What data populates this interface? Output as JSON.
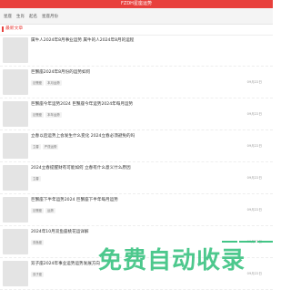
{
  "topbar": {
    "title": "FZDH星座运势"
  },
  "nav": [
    "星座",
    "生肖",
    "起名",
    "星座月份"
  ],
  "section": {
    "title": "最新文章"
  },
  "articles": [
    {
      "title": "属牛人2024年8月事业运势 属牛的人2024年8月的运程",
      "tags": [],
      "date": ""
    },
    {
      "title": "巨蟹座2024年8月份的运势如何",
      "tags": [
        "巨蟹座",
        "本月运势"
      ],
      "date": "09月22日"
    },
    {
      "title": "巨蟹座今年运势2024 巨蟹座今年运势2024年每月运势",
      "tags": [
        "巨蟹座",
        "本年运势"
      ],
      "date": "09月22日"
    },
    {
      "title": "立春以后运势上会发生什么变化 2024立春必须避免的吗",
      "tags": [
        "立春",
        "严谨运势"
      ],
      "date": "09月22日"
    },
    {
      "title": "2024立春提醒财有可能如何 立春有什么意义什么原因",
      "tags": [
        "立春"
      ],
      "date": "09月22日"
    },
    {
      "title": "巨蟹座下半年运势2024 巨蟹座下半年每月运势",
      "tags": [
        "巨蟹座",
        "运势"
      ],
      "date": "09月22日"
    },
    {
      "title": "2024年10月双鱼座桃花运详解",
      "tags": [
        "双鱼座"
      ],
      "date": "09月22日"
    },
    {
      "title": "双子座2024年事业运势运势发展方向",
      "tags": [
        "双子座"
      ],
      "date": "09月22日"
    }
  ],
  "watermark": {
    "text": "免费自动收录"
  },
  "colors": {
    "accent": "#e8403c",
    "watermark": "#2fbf7a"
  }
}
